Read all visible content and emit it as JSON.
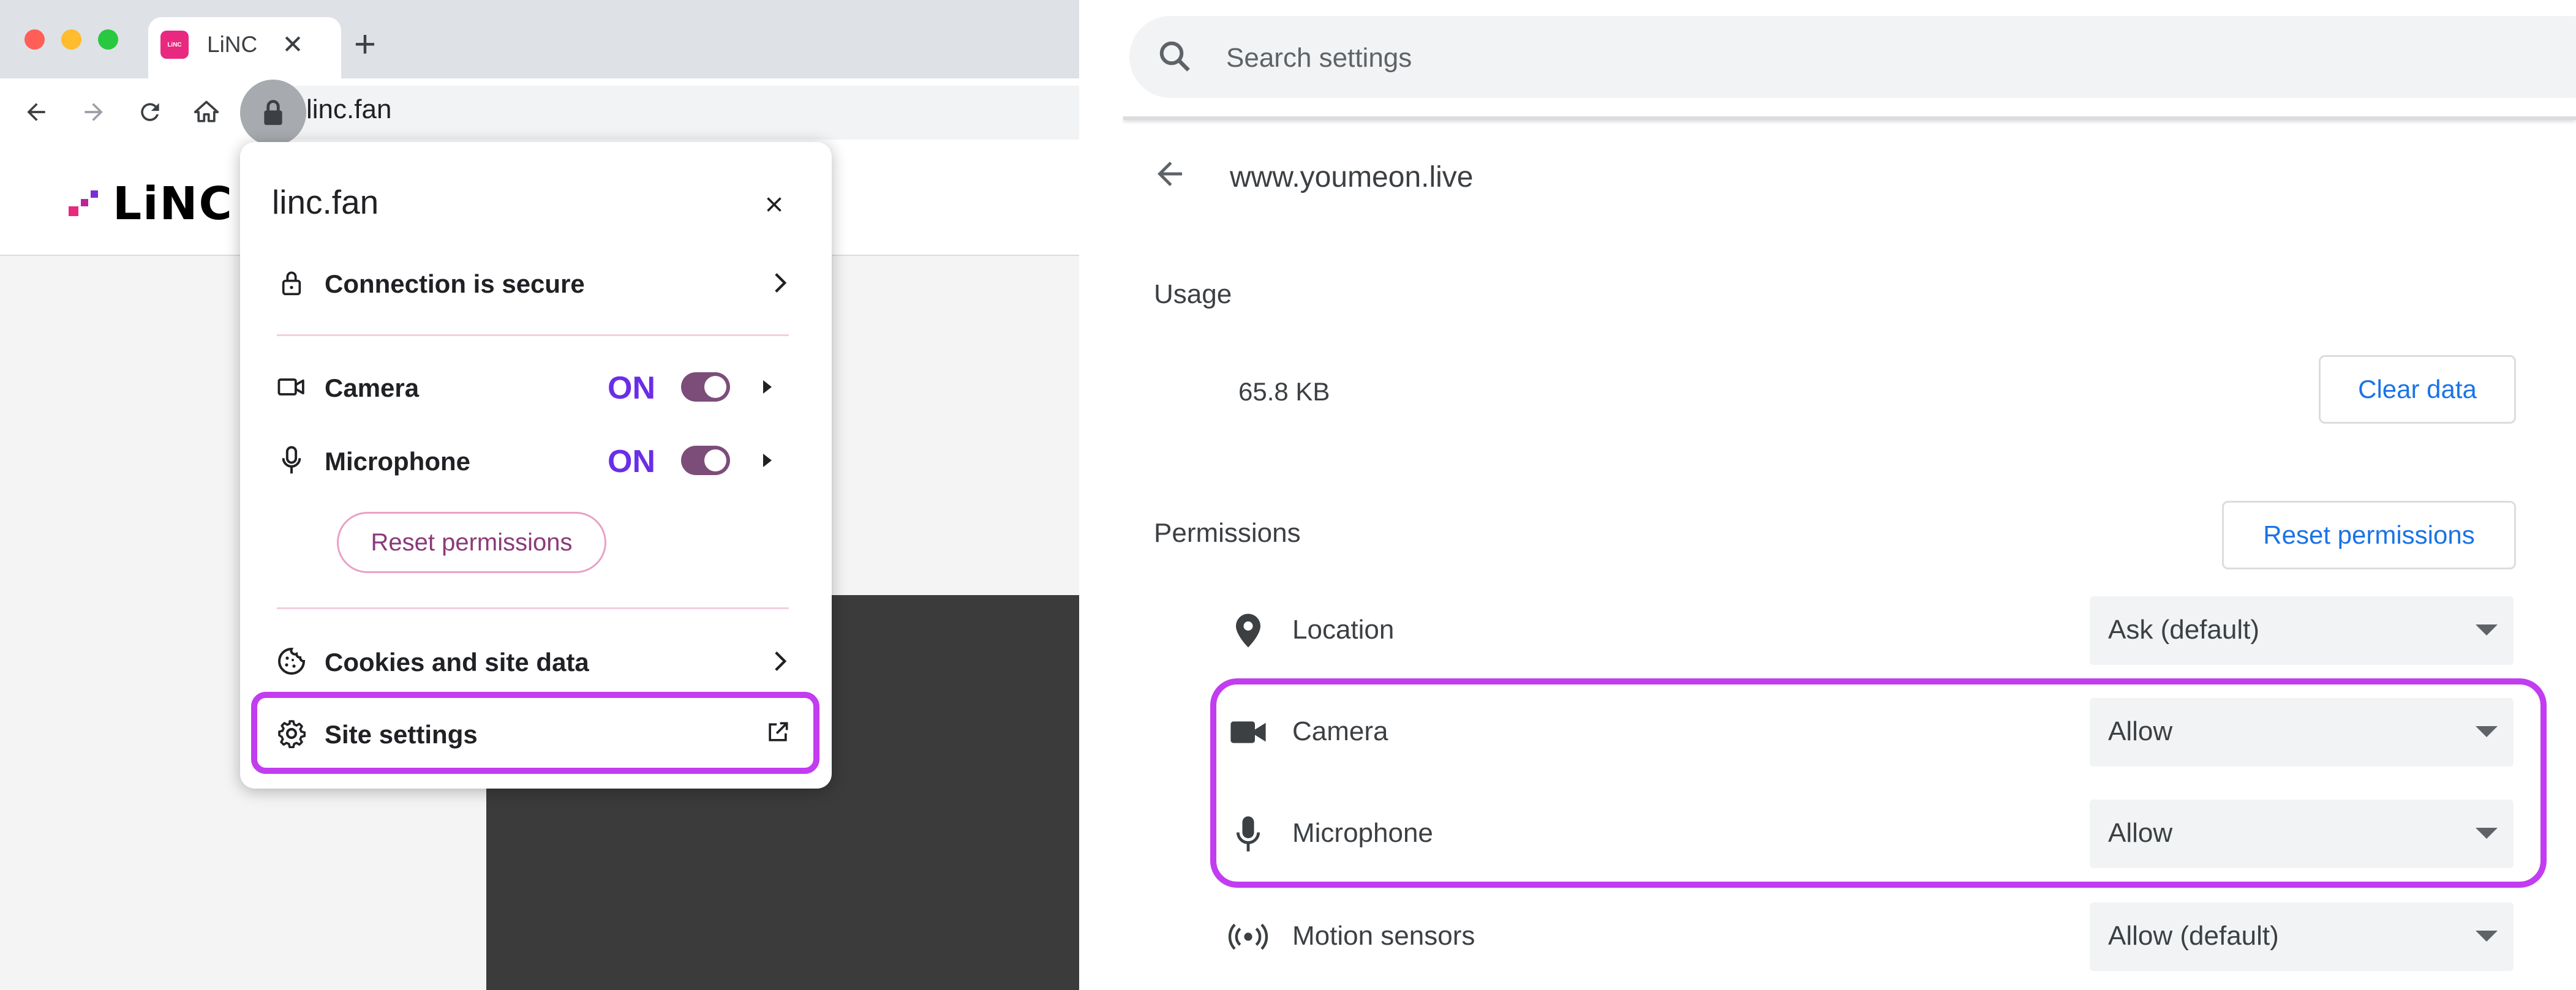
{
  "browser": {
    "tab": {
      "favicon_text": "LiNC",
      "title": "LiNC",
      "close_glyph": "✕"
    },
    "new_tab_glyph": "+",
    "toolbar": {
      "back_icon": "back-arrow-icon",
      "forward_icon": "forward-arrow-icon",
      "reload_icon": "reload-icon",
      "home_icon": "home-icon"
    },
    "url": "linc.fan",
    "site_logo_text": "LiNC"
  },
  "site_popup": {
    "title": "linc.fan",
    "connection_label": "Connection is secure",
    "permissions": [
      {
        "label": "Camera",
        "state_text": "ON",
        "enabled": true
      },
      {
        "label": "Microphone",
        "state_text": "ON",
        "enabled": true
      }
    ],
    "reset_label": "Reset permissions",
    "cookies_label": "Cookies and site data",
    "site_settings_label": "Site settings",
    "highlight_color": "#c23cf0"
  },
  "settings": {
    "search_placeholder": "Search settings",
    "site_origin": "www.youmeon.live",
    "usage": {
      "section_title": "Usage",
      "value": "65.8 KB",
      "clear_label": "Clear data"
    },
    "permissions": {
      "section_title": "Permissions",
      "reset_label": "Reset permissions",
      "items": [
        {
          "label": "Location",
          "value": "Ask (default)",
          "icon": "location-pin-icon"
        },
        {
          "label": "Camera",
          "value": "Allow",
          "icon": "camera-icon"
        },
        {
          "label": "Microphone",
          "value": "Allow",
          "icon": "microphone-icon"
        },
        {
          "label": "Motion sensors",
          "value": "Allow (default)",
          "icon": "motion-sensors-icon"
        }
      ]
    },
    "accent_color": "#1a73e8",
    "highlight_color": "#c23cf0"
  }
}
